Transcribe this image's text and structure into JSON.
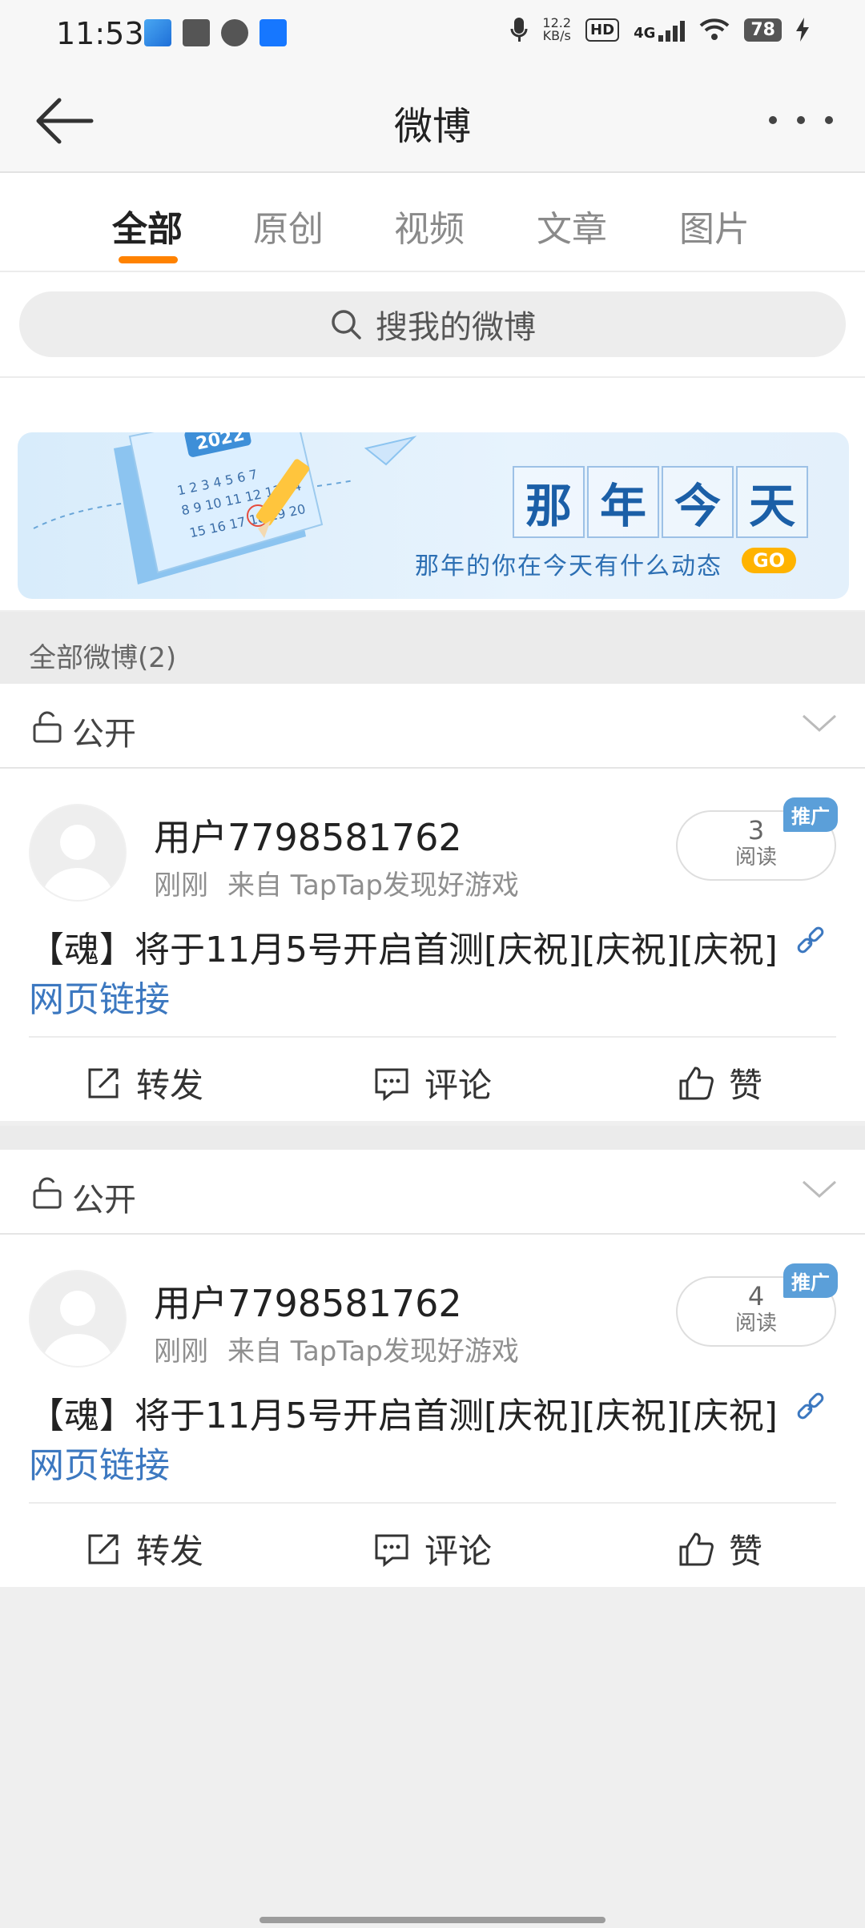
{
  "status_bar": {
    "time": "11:53",
    "net_speed_value": "12.2",
    "net_speed_unit": "KB/s",
    "hd": "HD",
    "network": "4G",
    "battery": "78"
  },
  "header": {
    "title": "微博"
  },
  "tabs": [
    {
      "label": "全部",
      "active": true
    },
    {
      "label": "原创",
      "active": false
    },
    {
      "label": "视频",
      "active": false
    },
    {
      "label": "文章",
      "active": false
    },
    {
      "label": "图片",
      "active": false
    }
  ],
  "search": {
    "placeholder": "搜我的微博"
  },
  "banner": {
    "year": "2022",
    "title_chars": [
      "那",
      "年",
      "今",
      "天"
    ],
    "subtitle": "那年的你在今天有什么动态",
    "go": "GO"
  },
  "section": {
    "label": "全部微博(2)"
  },
  "posts": [
    {
      "visibility": "公开",
      "user": "用户7798581762",
      "time": "刚刚",
      "source": "来自 TapTap发现好游戏",
      "read_count": "3",
      "read_label": "阅读",
      "promo": "推广",
      "content": "【魂】将于11月5号开启首测[庆祝][庆祝][庆祝]",
      "link_text": "网页链接",
      "actions": {
        "repost": "转发",
        "comment": "评论",
        "like": "赞"
      }
    },
    {
      "visibility": "公开",
      "user": "用户7798581762",
      "time": "刚刚",
      "source": "来自 TapTap发现好游戏",
      "read_count": "4",
      "read_label": "阅读",
      "promo": "推广",
      "content": "【魂】将于11月5号开启首测[庆祝][庆祝][庆祝]",
      "link_text": "网页链接",
      "actions": {
        "repost": "转发",
        "comment": "评论",
        "like": "赞"
      }
    }
  ],
  "colors": {
    "accent": "#ff8200",
    "link": "#3c78c0",
    "promo": "#5b9fd9"
  }
}
